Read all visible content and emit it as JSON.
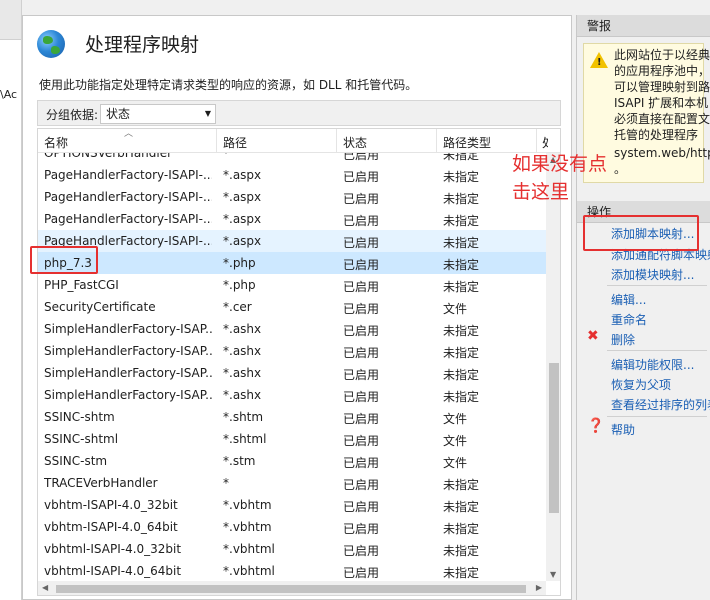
{
  "header": {
    "title": "处理程序映射",
    "description": "使用此功能指定处理特定请求类型的响应的资源，如 DLL 和托管代码。"
  },
  "left_tree": {
    "fragment": "\\Ac"
  },
  "groupby": {
    "label": "分组依据:",
    "value": "状态"
  },
  "table": {
    "columns": [
      "名称",
      "路径",
      "状态",
      "路径类型",
      "处"
    ],
    "partial_top_row": [
      "OPTIONSVerbHandler",
      "*",
      "已启用",
      "未指定"
    ],
    "rows": [
      {
        "name": "PageHandlerFactory-ISAPI-...",
        "path": "*.aspx",
        "state": "已启用",
        "type": "未指定"
      },
      {
        "name": "PageHandlerFactory-ISAPI-...",
        "path": "*.aspx",
        "state": "已启用",
        "type": "未指定"
      },
      {
        "name": "PageHandlerFactory-ISAPI-...",
        "path": "*.aspx",
        "state": "已启用",
        "type": "未指定"
      },
      {
        "name": "PageHandlerFactory-ISAPI-...",
        "path": "*.aspx",
        "state": "已启用",
        "type": "未指定"
      },
      {
        "name": "php_7.3",
        "path": "*.php",
        "state": "已启用",
        "type": "未指定"
      },
      {
        "name": "PHP_FastCGI",
        "path": "*.php",
        "state": "已启用",
        "type": "未指定"
      },
      {
        "name": "SecurityCertificate",
        "path": "*.cer",
        "state": "已启用",
        "type": "文件"
      },
      {
        "name": "SimpleHandlerFactory-ISAP...",
        "path": "*.ashx",
        "state": "已启用",
        "type": "未指定"
      },
      {
        "name": "SimpleHandlerFactory-ISAP...",
        "path": "*.ashx",
        "state": "已启用",
        "type": "未指定"
      },
      {
        "name": "SimpleHandlerFactory-ISAP...",
        "path": "*.ashx",
        "state": "已启用",
        "type": "未指定"
      },
      {
        "name": "SimpleHandlerFactory-ISAP...",
        "path": "*.ashx",
        "state": "已启用",
        "type": "未指定"
      },
      {
        "name": "SSINC-shtm",
        "path": "*.shtm",
        "state": "已启用",
        "type": "文件"
      },
      {
        "name": "SSINC-shtml",
        "path": "*.shtml",
        "state": "已启用",
        "type": "文件"
      },
      {
        "name": "SSINC-stm",
        "path": "*.stm",
        "state": "已启用",
        "type": "文件"
      },
      {
        "name": "TRACEVerbHandler",
        "path": "*",
        "state": "已启用",
        "type": "未指定"
      },
      {
        "name": "vbhtm-ISAPI-4.0_32bit",
        "path": "*.vbhtm",
        "state": "已启用",
        "type": "未指定"
      },
      {
        "name": "vbhtm-ISAPI-4.0_64bit",
        "path": "*.vbhtm",
        "state": "已启用",
        "type": "未指定"
      },
      {
        "name": "vbhtml-ISAPI-4.0_32bit",
        "path": "*.vbhtml",
        "state": "已启用",
        "type": "未指定"
      },
      {
        "name": "vbhtml-ISAPI-4.0_64bit",
        "path": "*.vbhtml",
        "state": "已启用",
        "type": "未指定"
      }
    ],
    "selected_index": 4,
    "hover_index": 3
  },
  "annotation": {
    "lines": [
      "如果没有点",
      "击这里"
    ],
    "color": "#e53030"
  },
  "alerts_pane": {
    "title": "警报",
    "lines": [
      "此网站位于以经典",
      "的应用程序池中，",
      "可以管理映射到路",
      "ISAPI 扩展和本机",
      "必须直接在配置文",
      "托管的处理程序",
      "system.web/http",
      "。"
    ]
  },
  "actions_pane": {
    "title": "操作",
    "items": [
      {
        "label": "添加脚本映射...",
        "icon": ""
      },
      {
        "label": "添加通配符脚本映射",
        "icon": ""
      },
      {
        "label": "添加模块映射...",
        "icon": ""
      },
      {
        "label": "编辑...",
        "icon": ""
      },
      {
        "label": "重命名",
        "icon": ""
      },
      {
        "label": "删除",
        "icon": "delete-x-icon"
      },
      {
        "label": "编辑功能权限...",
        "icon": ""
      },
      {
        "label": "恢复为父项",
        "icon": ""
      },
      {
        "label": "查看经过排序的列表",
        "icon": ""
      },
      {
        "label": "帮助",
        "icon": "help-icon"
      }
    ]
  },
  "colors": {
    "link": "#1a5fb4",
    "selection": "#cde8ff",
    "alert_bg": "#fffbe0",
    "red": "#e53030"
  }
}
